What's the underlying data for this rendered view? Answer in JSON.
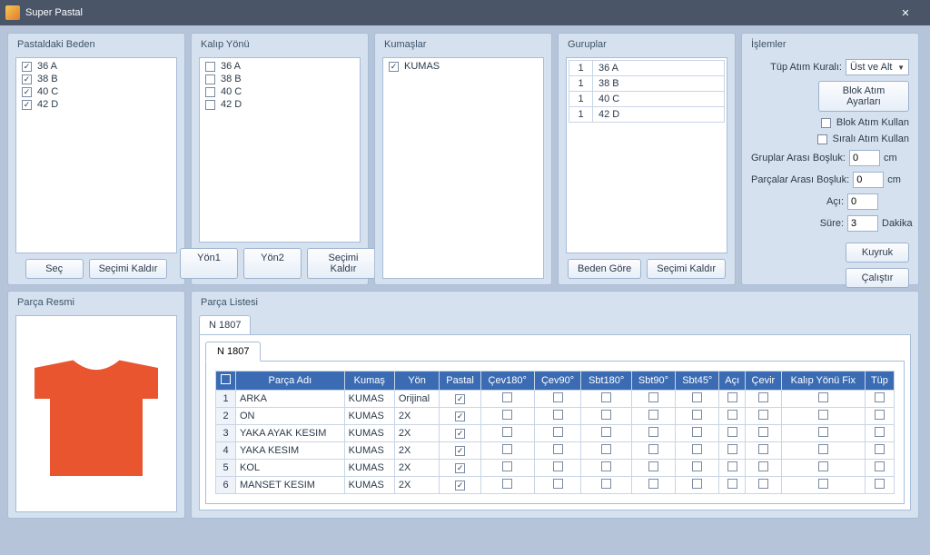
{
  "window": {
    "title": "Super Pastal"
  },
  "pastaldaki_beden": {
    "title": "Pastaldaki Beden",
    "items": [
      {
        "label": "36 A",
        "checked": true
      },
      {
        "label": "38 B",
        "checked": true
      },
      {
        "label": "40 C",
        "checked": true
      },
      {
        "label": "42 D",
        "checked": true
      }
    ],
    "btn_sec": "Seç",
    "btn_secimi_kaldir": "Seçimi Kaldır"
  },
  "kalip_yonu": {
    "title": "Kalıp Yönü",
    "items": [
      {
        "label": "36 A",
        "checked": false
      },
      {
        "label": "38 B",
        "checked": false
      },
      {
        "label": "40 C",
        "checked": false
      },
      {
        "label": "42 D",
        "checked": false
      }
    ],
    "btn_yon1": "Yön1",
    "btn_yon2": "Yön2",
    "btn_secimi_kaldir": "Seçimi Kaldır"
  },
  "kumaslar": {
    "title": "Kumaşlar",
    "items": [
      {
        "label": "KUMAS",
        "checked": true
      }
    ]
  },
  "guruplar": {
    "title": "Guruplar",
    "rows": [
      {
        "count": "1",
        "label": "36 A"
      },
      {
        "count": "1",
        "label": "38 B"
      },
      {
        "count": "1",
        "label": "40 C"
      },
      {
        "count": "1",
        "label": "42 D"
      }
    ],
    "btn_beden_gore": "Beden Göre",
    "btn_secimi_kaldir": "Seçimi Kaldır"
  },
  "islemler": {
    "title": "İşlemler",
    "tup_atim_kurali_label": "Tüp Atım Kuralı:",
    "tup_atim_kurali_value": "Üst ve Alt",
    "blok_atim_ayarlari": "Blok Atım Ayarları",
    "blok_atim_kullan": "Blok Atım Kullan",
    "sirali_atim_kullan": "Sıralı Atım Kullan",
    "gruplar_arasi_bosluk_label": "Gruplar Arası Boşluk:",
    "gruplar_arasi_bosluk_value": "0",
    "parcalar_arasi_bosluk_label": "Parçalar Arası Boşluk:",
    "parcalar_arasi_bosluk_value": "0",
    "aci_label": "Açı:",
    "aci_value": "0",
    "sure_label": "Süre:",
    "sure_value": "3",
    "cm": "cm",
    "dakika": "Dakika",
    "kuyruk": "Kuyruk",
    "calistir": "Çalıştır"
  },
  "parca_resmi": {
    "title": "Parça Resmi"
  },
  "parca_listesi": {
    "title": "Parça Listesi",
    "tab": "N 1807",
    "inner_tab": "N 1807",
    "headers": [
      "",
      "Parça Adı",
      "Kumaş",
      "Yön",
      "Pastal",
      "Çev180°",
      "Çev90°",
      "Sbt180°",
      "Sbt90°",
      "Sbt45°",
      "Açı",
      "Çevir",
      "Kalıp Yönü Fix",
      "Tüp"
    ],
    "rows": [
      {
        "n": "1",
        "ad": "ARKA",
        "kumas": "KUMAS",
        "yon": "Orijinal",
        "pastal": true
      },
      {
        "n": "2",
        "ad": "ON",
        "kumas": "KUMAS",
        "yon": "2X",
        "pastal": true
      },
      {
        "n": "3",
        "ad": "YAKA AYAK KESIM",
        "kumas": "KUMAS",
        "yon": "2X",
        "pastal": true
      },
      {
        "n": "4",
        "ad": "YAKA KESIM",
        "kumas": "KUMAS",
        "yon": "2X",
        "pastal": true
      },
      {
        "n": "5",
        "ad": "KOL",
        "kumas": "KUMAS",
        "yon": "2X",
        "pastal": true
      },
      {
        "n": "6",
        "ad": "MANSET KESIM",
        "kumas": "KUMAS",
        "yon": "2X",
        "pastal": true
      }
    ]
  }
}
